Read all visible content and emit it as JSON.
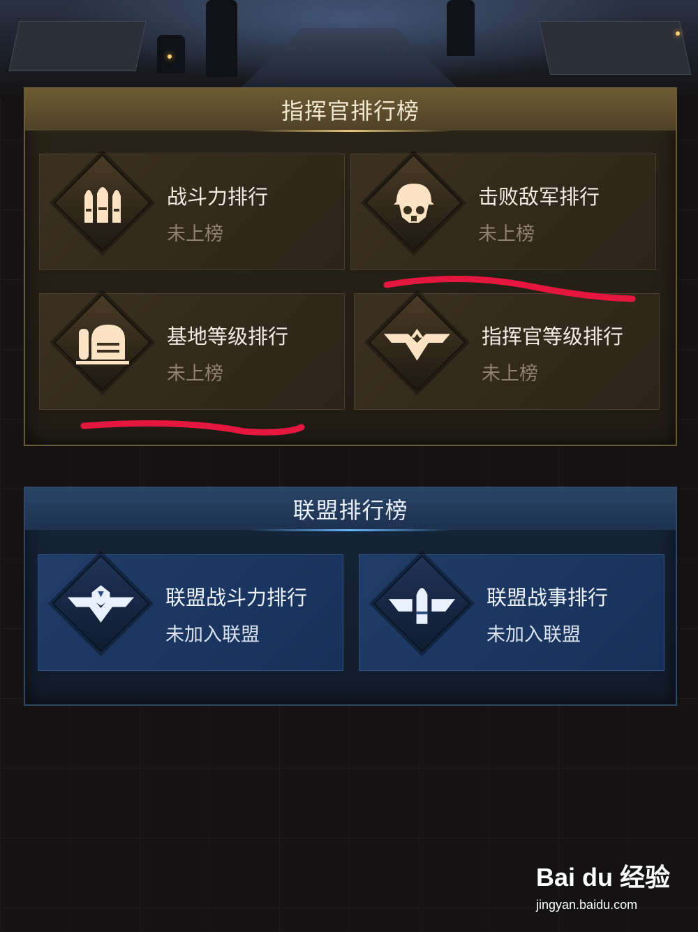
{
  "commander_board": {
    "title": "指挥官排行榜",
    "cards": [
      {
        "title": "战斗力排行",
        "status": "未上榜",
        "icon": "bullets-icon"
      },
      {
        "title": "击败敌军排行",
        "status": "未上榜",
        "icon": "soldier-mask-icon"
      },
      {
        "title": "基地等级排行",
        "status": "未上榜",
        "icon": "base-building-icon"
      },
      {
        "title": "指挥官等级排行",
        "status": "未上榜",
        "icon": "winged-chevron-icon"
      }
    ]
  },
  "alliance_board": {
    "title": "联盟排行榜",
    "cards": [
      {
        "title": "联盟战斗力排行",
        "status": "未加入联盟",
        "icon": "alliance-wings-icon"
      },
      {
        "title": "联盟战事排行",
        "status": "未加入联盟",
        "icon": "winged-bullet-icon"
      }
    ]
  },
  "watermark": {
    "logo": "Bai du 经验",
    "url": "jingyan.baidu.com"
  },
  "colors": {
    "commander_accent": "#e8c77a",
    "alliance_accent": "#66b8ff",
    "annotation_red": "#e5173f"
  }
}
